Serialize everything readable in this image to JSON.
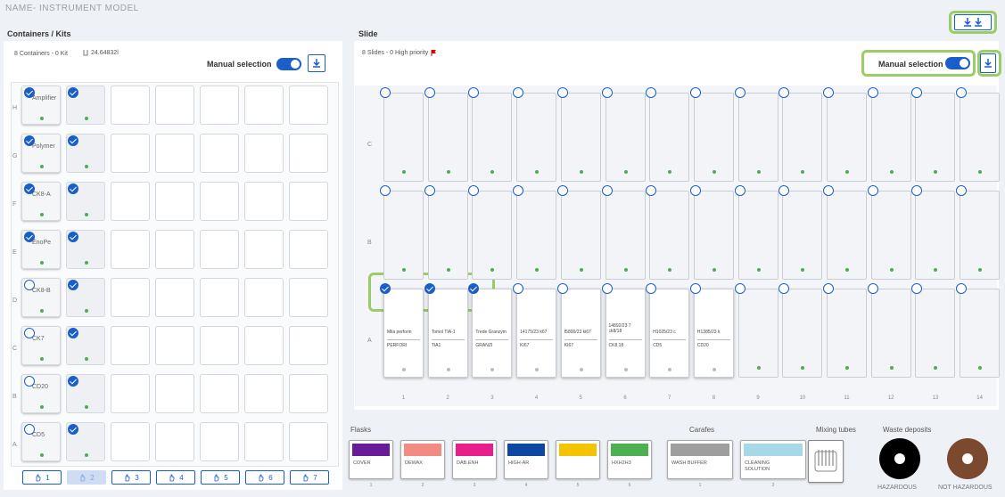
{
  "header": {
    "title": "NAME- INSTRUMENT MODEL"
  },
  "containers": {
    "section_title": "Containers / Kits",
    "summary": "8 Containers - 0 Kit",
    "volume": "24.64832l",
    "manual_selection_label": "Manual selection",
    "rows": [
      {
        "label": "H",
        "reagent": "Amplifier",
        "checked": true
      },
      {
        "label": "G",
        "reagent": "Polymer",
        "checked": true
      },
      {
        "label": "F",
        "reagent": "CK8-A",
        "checked": true
      },
      {
        "label": "E",
        "reagent": "EnoPe",
        "checked": true
      },
      {
        "label": "D",
        "reagent": "CK8-B",
        "checked": false
      },
      {
        "label": "C",
        "reagent": "CK7",
        "checked": false
      },
      {
        "label": "B",
        "reagent": "CD20",
        "checked": false
      },
      {
        "label": "A",
        "reagent": "CD5",
        "checked": false
      }
    ],
    "tabs": [
      "1",
      "2",
      "3",
      "4",
      "5",
      "6",
      "7"
    ],
    "active_tab": "2"
  },
  "slide": {
    "section_title": "Slide",
    "summary": "8 Slides - 0 High priority",
    "manual_selection_label": "Manual selection",
    "row_labels": [
      "C",
      "B",
      "A"
    ],
    "column_numbers": [
      "1",
      "2",
      "3",
      "4",
      "5",
      "6",
      "7",
      "8",
      "9",
      "10",
      "11",
      "12",
      "13",
      "14"
    ],
    "slides_a": [
      {
        "name": "Mila perforin",
        "code": "PERFORI",
        "checked": true
      },
      {
        "name": "Tomol TIA-1",
        "code": "TIA1",
        "checked": true
      },
      {
        "name": "Trede Granzym",
        "code": "GRANZI",
        "checked": true
      },
      {
        "name": "14175/23 k67",
        "code": "KI67",
        "checked": false
      },
      {
        "name": "f5800/23 ki67",
        "code": "KI67",
        "checked": false
      },
      {
        "name": "14892/23 7 ck8/18",
        "code": "CK8.18",
        "checked": false
      },
      {
        "name": "H1025/23 c",
        "code": "CD5",
        "checked": false
      },
      {
        "name": "H1385/23 k",
        "code": "CD20",
        "checked": false
      }
    ]
  },
  "flasks": {
    "section_title": "Flasks",
    "items": [
      {
        "label": "COVER",
        "color": "#6a1b9a",
        "num": "1"
      },
      {
        "label": "DEWAX",
        "color": "#f28b82",
        "num": "2"
      },
      {
        "label": "DAB.ENH",
        "color": "#e91e8c",
        "num": "3"
      },
      {
        "label": "HIGH-AR",
        "color": "#0d47a1",
        "num": "4"
      },
      {
        "label": "",
        "color": "#f4c400",
        "num": "5"
      },
      {
        "label": "HXH2H3",
        "color": "#4caf50",
        "num": "6"
      }
    ]
  },
  "carafes": {
    "section_title": "Carafes",
    "items": [
      {
        "label": "WASH BUFFER",
        "color": "#9e9e9e",
        "num": "1"
      },
      {
        "label": "CLEANING SOLUTION",
        "color": "#a7d8e8",
        "num": "2"
      }
    ]
  },
  "mixing": {
    "section_title": "Mixing tubes"
  },
  "waste": {
    "section_title": "Waste deposits",
    "items": [
      {
        "label": "HAZARDOUS",
        "color": "#000000"
      },
      {
        "label": "NOT HAZARDOUS",
        "color": "#7b4a2e"
      }
    ]
  },
  "colors": {
    "accent": "#1a5fc9",
    "highlight": "#9ccc65",
    "ok": "#4caf50"
  }
}
